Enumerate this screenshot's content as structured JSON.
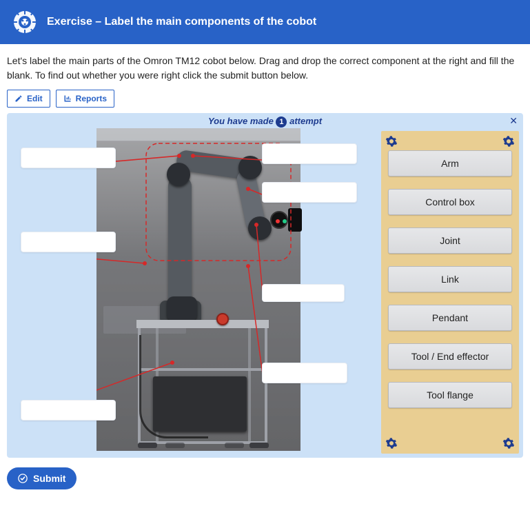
{
  "header": {
    "title": "Exercise – Label the main components of the cobot"
  },
  "intro": "Let's label the main parts of the Omron TM12 cobot below. Drag and drop the correct component at the right and fill the blank. To find out whether you were right click the submit button below.",
  "actions": {
    "edit": "Edit",
    "reports": "Reports"
  },
  "status": {
    "prefix": "You have made",
    "count": "1",
    "suffix": "attempt"
  },
  "options": [
    "Arm",
    "Control box",
    "Joint",
    "Link",
    "Pendant",
    "Tool / End effector",
    "Tool flange"
  ],
  "submit": "Submit"
}
